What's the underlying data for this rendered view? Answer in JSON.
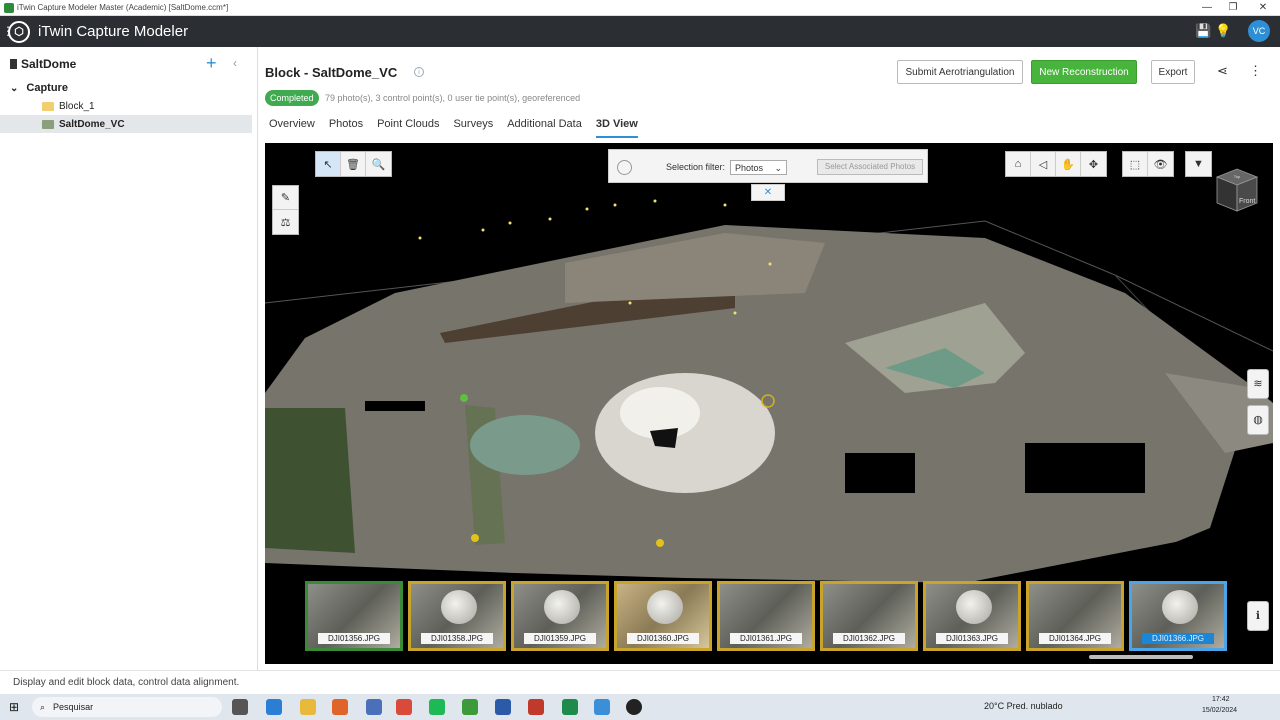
{
  "window": {
    "title": "iTwin Capture Modeler Master (Academic) [SaltDome.ccm*]",
    "minimize": "—",
    "maximize": "❐",
    "close": "✕"
  },
  "appbar": {
    "app_name": "iTwin Capture Modeler",
    "logo": "⬡",
    "menu": "⋮",
    "save_icon": "💾",
    "bulb_icon": "💡",
    "avatar": "VC"
  },
  "sidebar": {
    "project": "SaltDome",
    "add": "+",
    "collapse": "‹",
    "tree": [
      {
        "label": "Capture",
        "expander": "⌄"
      },
      {
        "label": "Block_1"
      },
      {
        "label": "SaltDome_VC"
      }
    ]
  },
  "status_text": "Display and edit block data, control data alignment.",
  "block": {
    "title": "Block -  SaltDome_VC",
    "info": "i",
    "badge": "Completed",
    "summary": "79 photo(s), 3 control point(s), 0 user tie point(s), georeferenced",
    "buttons": {
      "submit": "Submit Aerotriangulation",
      "new_reconstruction": "New Reconstruction",
      "export": "Export"
    },
    "share_icon": "⋖",
    "more_icon": "⋮"
  },
  "tabs": [
    {
      "label": "Overview"
    },
    {
      "label": "Photos"
    },
    {
      "label": "Point Clouds"
    },
    {
      "label": "Surveys"
    },
    {
      "label": "Additional Data"
    },
    {
      "label": "3D View"
    }
  ],
  "active_tab": "3D View",
  "viewer": {
    "left_toolbar": [
      "↖",
      "🗑",
      "🔍"
    ],
    "side_tools": [
      "✎",
      "⚖"
    ],
    "filter_label": "Selection filter:",
    "filter_value": "Photos",
    "filter_caret": "⌄",
    "associated_button": "Select Associated Photos",
    "pin_tab": "✕",
    "right_toolbar_a": [
      "⌂",
      "◁",
      "✋",
      "✥"
    ],
    "right_toolbar_b": [
      "⬚",
      "👁"
    ],
    "right_toolbar_c": [
      "▼"
    ],
    "cube_top": "Top",
    "cube_front": "Front",
    "layers_icon": "≋",
    "globe_icon": "◍",
    "info_icon": "ℹ"
  },
  "photos": [
    "DJI01356.JPG",
    "DJI01358.JPG",
    "DJI01359.JPG",
    "DJI01360.JPG",
    "DJI01361.JPG",
    "DJI01362.JPG",
    "DJI01363.JPG",
    "DJI01364.JPG",
    "DJI01366.JPG"
  ],
  "selected_photo": "DJI01366.JPG",
  "taskbar": {
    "start": "⊞",
    "search_placeholder": "Pesquisar",
    "weather": "20°C  Pred. nublado",
    "time": "17:42",
    "date": "15/02/2024"
  },
  "colors": {
    "accent": "#2f8fd6",
    "primary_button": "#47b53b",
    "status_completed": "#3faa4f",
    "header_bg": "#2b2f33"
  }
}
